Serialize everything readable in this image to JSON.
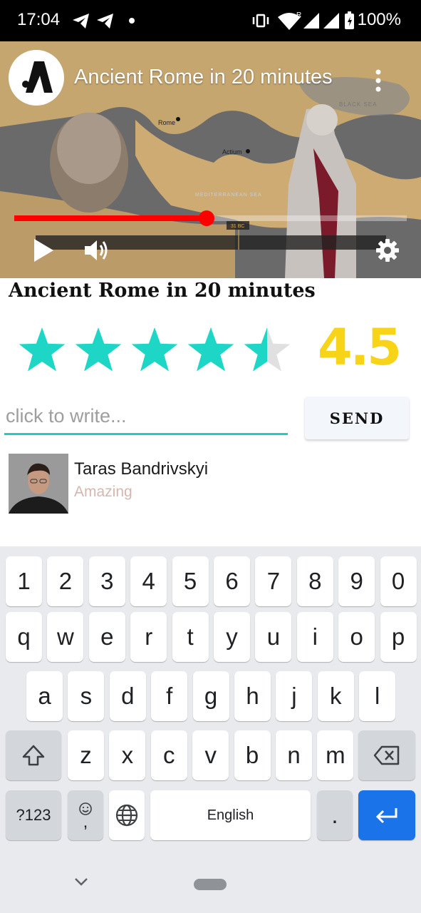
{
  "status_bar": {
    "time": "17:04",
    "battery": "100%",
    "icons": [
      "telegram-icon",
      "telegram-icon",
      "dot-icon",
      "vibrate-icon",
      "wifi-icon",
      "signal-icon",
      "signal-icon",
      "battery-icon"
    ]
  },
  "video": {
    "title": "Ancient Rome in 20 minutes",
    "progress": 0.49,
    "map_labels": {
      "rome": "Rome",
      "actium": "Actium",
      "black_sea": "BLACK SEA",
      "mediterranean": "MEDITERRANEAN SEA",
      "timeline_marker": "31 BC"
    },
    "controls": [
      "play-icon",
      "volume-icon",
      "settings-icon"
    ]
  },
  "content": {
    "title": "Ancient Rome in 20 minutes",
    "rating": {
      "value": "4.5",
      "stars": 4.5,
      "max": 5,
      "star_color": "#1ed6c6",
      "value_color": "#f7d417"
    }
  },
  "comment": {
    "placeholder": "click to write...",
    "send_label": "SEND"
  },
  "reviews": [
    {
      "name": "Taras Bandrivskyi",
      "text": "Amazing"
    }
  ],
  "keyboard": {
    "row_numbers": [
      "1",
      "2",
      "3",
      "4",
      "5",
      "6",
      "7",
      "8",
      "9",
      "0"
    ],
    "row_top": [
      "q",
      "w",
      "e",
      "r",
      "t",
      "y",
      "u",
      "i",
      "o",
      "p"
    ],
    "row_middle": [
      "a",
      "s",
      "d",
      "f",
      "g",
      "h",
      "j",
      "k",
      "l"
    ],
    "row_bottom": [
      "z",
      "x",
      "c",
      "v",
      "b",
      "n",
      "m"
    ],
    "symbols_label": "?123",
    "emoji_comma_label": ",",
    "space_label": "English",
    "period_label": ".",
    "accent_color": "#1a73e8"
  }
}
